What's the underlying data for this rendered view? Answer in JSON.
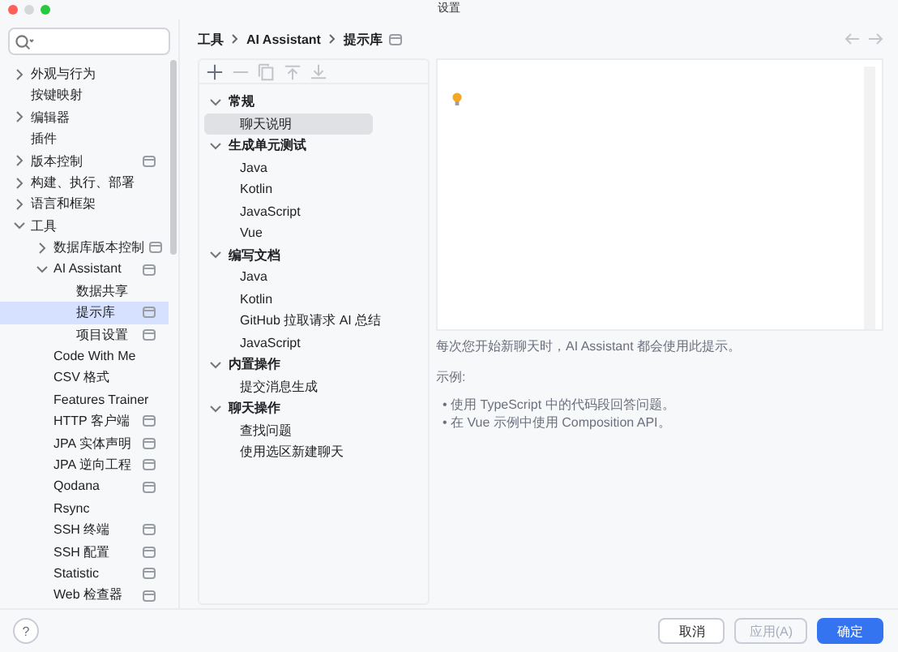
{
  "window": {
    "title": "设置"
  },
  "sidebar": {
    "items": [
      {
        "label": "外观与行为",
        "expanded": false,
        "selected": false,
        "project_scope": false
      },
      {
        "label": "按键映射",
        "selected": false,
        "project_scope": false
      },
      {
        "label": "编辑器",
        "expanded": false,
        "selected": false,
        "project_scope": false
      },
      {
        "label": "插件",
        "selected": false,
        "project_scope": false
      },
      {
        "label": "版本控制",
        "expanded": false,
        "selected": false,
        "project_scope": true
      },
      {
        "label": "构建、执行、部署",
        "expanded": false,
        "selected": false,
        "project_scope": false
      },
      {
        "label": "语言和框架",
        "expanded": false,
        "selected": false,
        "project_scope": false
      },
      {
        "label": "工具",
        "expanded": true,
        "selected": false,
        "project_scope": false,
        "children": [
          {
            "label": "数据库版本控制",
            "expanded": false,
            "selected": false,
            "project_scope": true
          },
          {
            "label": "AI Assistant",
            "expanded": true,
            "selected": false,
            "project_scope": true,
            "children": [
              {
                "label": "数据共享",
                "selected": false,
                "project_scope": false
              },
              {
                "label": "提示库",
                "selected": true,
                "project_scope": true
              },
              {
                "label": "项目设置",
                "selected": false,
                "project_scope": true
              }
            ]
          },
          {
            "label": "Code With Me",
            "selected": false,
            "project_scope": false
          },
          {
            "label": "CSV 格式",
            "selected": false,
            "project_scope": false
          },
          {
            "label": "Features Trainer",
            "selected": false,
            "project_scope": false
          },
          {
            "label": "HTTP 客户端",
            "selected": false,
            "project_scope": true
          },
          {
            "label": "JPA 实体声明",
            "selected": false,
            "project_scope": true
          },
          {
            "label": "JPA 逆向工程",
            "selected": false,
            "project_scope": true
          },
          {
            "label": "Qodana",
            "selected": false,
            "project_scope": true
          },
          {
            "label": "Rsync",
            "selected": false,
            "project_scope": false
          },
          {
            "label": "SSH 终端",
            "selected": false,
            "project_scope": true
          },
          {
            "label": "SSH 配置",
            "selected": false,
            "project_scope": true
          },
          {
            "label": "Statistic",
            "selected": false,
            "project_scope": true
          },
          {
            "label": "Web 检查器",
            "selected": false,
            "project_scope": true
          }
        ]
      }
    ]
  },
  "breadcrumb": [
    "工具",
    "AI Assistant",
    "提示库"
  ],
  "toolbar": [
    {
      "kind": "add",
      "disabled": false
    },
    {
      "kind": "remove",
      "disabled": true
    },
    {
      "kind": "copy",
      "disabled": true
    },
    {
      "kind": "up",
      "disabled": true
    },
    {
      "kind": "down",
      "disabled": true
    }
  ],
  "prompts": [
    {
      "label": "常规",
      "expanded": true,
      "selected": false,
      "children": [
        {
          "label": "聊天说明",
          "selected": true
        }
      ]
    },
    {
      "label": "生成单元测试",
      "expanded": true,
      "selected": false,
      "children": [
        {
          "label": "Java",
          "selected": false
        },
        {
          "label": "Kotlin",
          "selected": false
        },
        {
          "label": "JavaScript",
          "selected": false
        },
        {
          "label": "Vue",
          "selected": false
        }
      ]
    },
    {
      "label": "编写文档",
      "expanded": true,
      "selected": false,
      "children": [
        {
          "label": "Java",
          "selected": false
        },
        {
          "label": "Kotlin",
          "selected": false
        },
        {
          "label": "GitHub 拉取请求 AI 总结",
          "selected": false
        },
        {
          "label": "JavaScript",
          "selected": false
        }
      ]
    },
    {
      "label": "内置操作",
      "expanded": true,
      "selected": false,
      "children": [
        {
          "label": "提交消息生成",
          "selected": false
        }
      ]
    },
    {
      "label": "聊天操作",
      "expanded": true,
      "selected": false,
      "children": [
        {
          "label": "查找问题",
          "selected": false
        },
        {
          "label": "使用选区新建聊天",
          "selected": false
        }
      ]
    }
  ],
  "description": "每次您开始新聊天时，AI Assistant 都会使用此提示。",
  "examples_label": "示例:",
  "examples": [
    "• 使用 TypeScript 中的代码段回答问题。",
    "• 在 Vue 示例中使用 Composition API。"
  ],
  "buttons": [
    {
      "label": "取消",
      "kind": "normal",
      "disabled": false
    },
    {
      "label": "应用(A)",
      "kind": "normal",
      "disabled": true
    },
    {
      "label": "确定",
      "kind": "primary",
      "disabled": false
    }
  ],
  "help": "?"
}
